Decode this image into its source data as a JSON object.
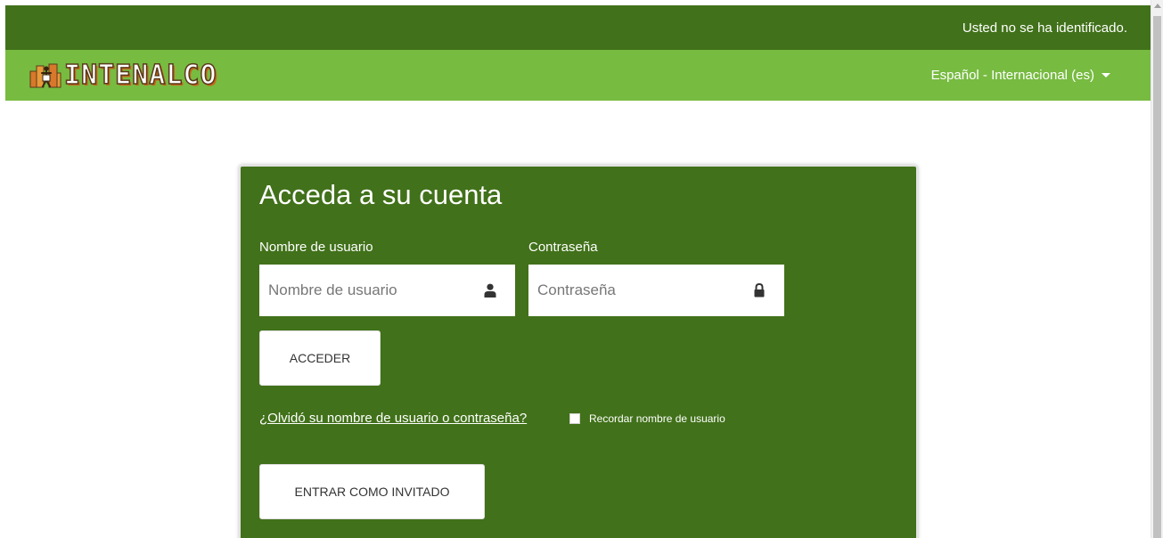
{
  "topbar": {
    "login_status": "Usted no se ha identificado."
  },
  "navbar": {
    "logo_text": "INTENALCO",
    "language": "Español - Internacional (es)"
  },
  "login": {
    "title": "Acceda a su cuenta",
    "username_label": "Nombre de usuario",
    "username_placeholder": "Nombre de usuario",
    "password_label": "Contraseña",
    "password_placeholder": "Contraseña",
    "login_button": "ACCEDER",
    "forgot_link": "¿Olvidó su nombre de usuario o contraseña?",
    "remember_label": "Recordar nombre de usuario",
    "guest_button": "ENTRAR COMO INVITADO"
  },
  "colors": {
    "dark_green": "#41711a",
    "light_green": "#77bb41",
    "white": "#ffffff"
  },
  "icons": {
    "user_field": "user-icon",
    "password_field": "lock-icon",
    "language_menu": "caret-down-icon"
  }
}
